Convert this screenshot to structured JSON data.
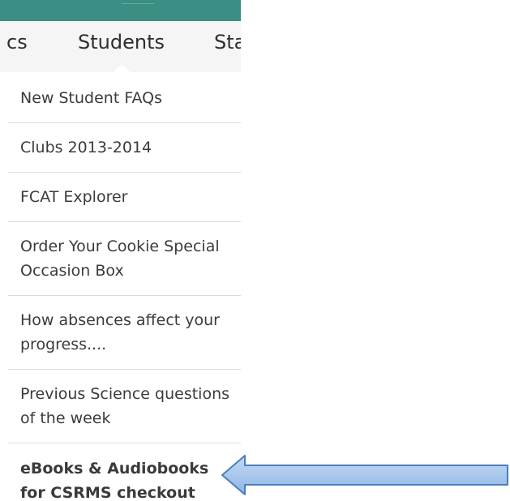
{
  "nav": {
    "items": [
      {
        "label": "cs"
      },
      {
        "label": "Students"
      },
      {
        "label": "Sta"
      }
    ]
  },
  "dropdown": {
    "items": [
      {
        "label": "New Student FAQs"
      },
      {
        "label": "Clubs 2013-2014"
      },
      {
        "label": "FCAT Explorer"
      },
      {
        "label": "Order Your Cookie Special Occasion Box"
      },
      {
        "label": "How absences affect your progress...."
      },
      {
        "label": "Previous Science questions of the week"
      },
      {
        "label": "eBooks & Audiobooks for CSRMS checkout"
      }
    ]
  },
  "colors": {
    "header_band": "#3a8e84",
    "nav_background": "#f5f5f5",
    "divider": "#dcdcdc",
    "text": "#3b3b3b",
    "arrow_fill": "#a9c8ec",
    "arrow_stroke": "#4a7ebb"
  },
  "icons": {
    "pointer": "left-arrow-icon"
  }
}
